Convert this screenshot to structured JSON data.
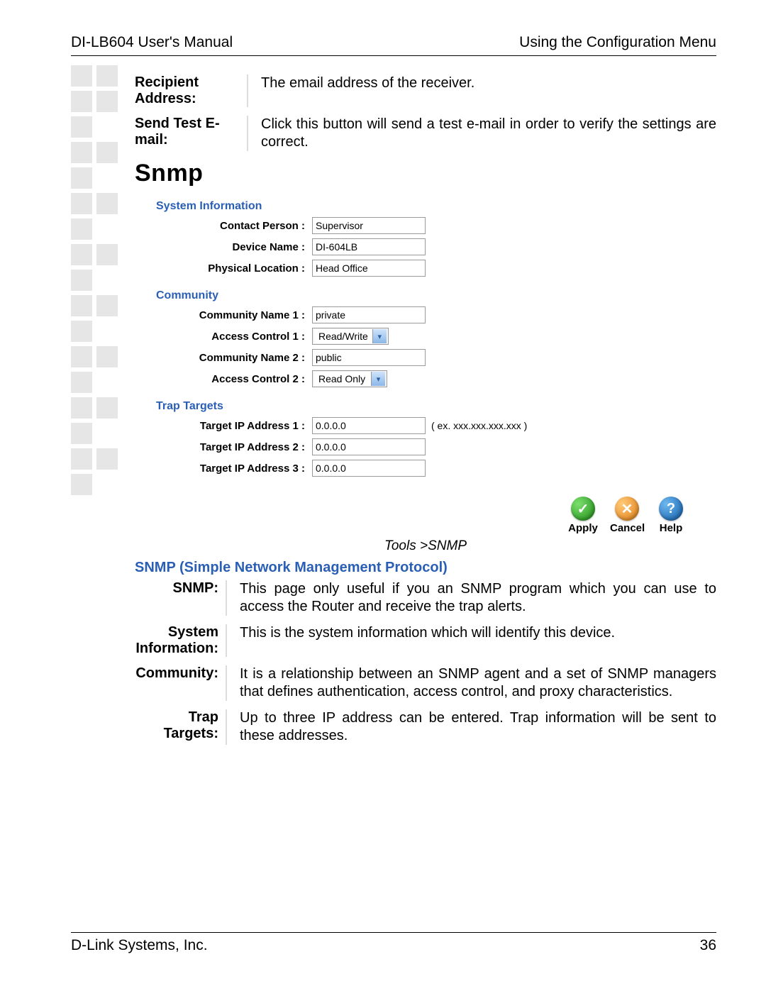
{
  "header": {
    "left": "DI-LB604 User's Manual",
    "right": "Using the Configuration Menu"
  },
  "footer": {
    "left": "D-Link Systems, Inc.",
    "page": "36"
  },
  "defs_top": [
    {
      "label": "Recipient Address:",
      "desc": "The email address of the receiver."
    },
    {
      "label": "Send Test E-mail:",
      "desc": "Click this button will send a test e-mail in order to verify the settings are correct."
    }
  ],
  "snmp_heading": "Snmp",
  "screenshot": {
    "sys_info_h": "System Information",
    "contact_label": "Contact Person :",
    "contact_value": "Supervisor",
    "device_label": "Device Name :",
    "device_value": "DI-604LB",
    "loc_label": "Physical Location :",
    "loc_value": "Head Office",
    "community_h": "Community",
    "cn1_label": "Community Name 1 :",
    "cn1_value": "private",
    "ac1_label": "Access Control 1 :",
    "ac1_value": "Read/Write",
    "cn2_label": "Community Name 2 :",
    "cn2_value": "public",
    "ac2_label": "Access Control 2 :",
    "ac2_value": "Read Only",
    "trap_h": "Trap Targets",
    "t1_label": "Target IP Address 1 :",
    "t1_value": "0.0.0.0",
    "t1_hint": "( ex. xxx.xxx.xxx.xxx )",
    "t2_label": "Target IP Address 2 :",
    "t2_value": "0.0.0.0",
    "t3_label": "Target IP Address 3 :",
    "t3_value": "0.0.0.0",
    "btn_apply": "Apply",
    "btn_cancel": "Cancel",
    "btn_help": "Help"
  },
  "breadcrumb": "Tools >SNMP",
  "section_title": "SNMP (Simple Network Management Protocol)",
  "defs_bottom": [
    {
      "label": "SNMP:",
      "desc": "This page only useful if you an SNMP program which you can use to access the Router and receive the trap alerts."
    },
    {
      "label": "System Information:",
      "desc": "This is the system information which will identify this device."
    },
    {
      "label": "Community:",
      "desc": "It is a relationship between an SNMP agent and a set of SNMP managers that defines authentication, access control, and proxy characteristics."
    },
    {
      "label": "Trap Targets:",
      "desc": "Up to three IP address can be entered. Trap information will be sent to these addresses."
    }
  ]
}
